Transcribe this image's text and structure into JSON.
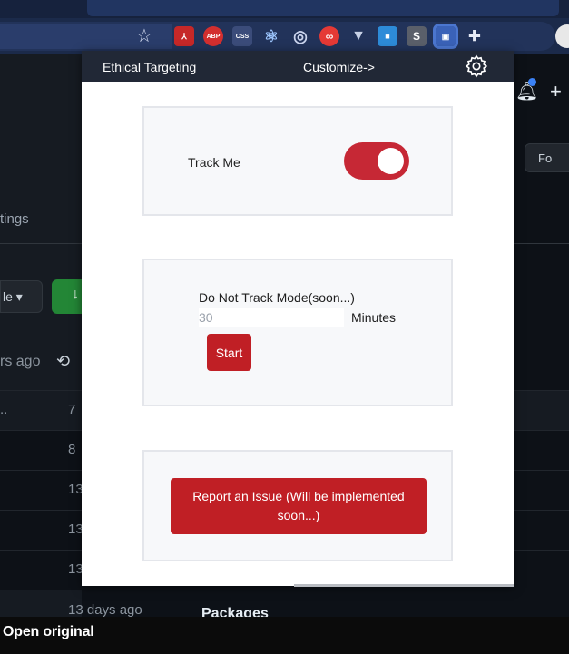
{
  "browser": {
    "extensions": [
      "pdf-icon",
      "abp-icon",
      "css-icon",
      "react-icon",
      "target-icon",
      "infinity-icon",
      "vue-icon",
      "blue-ext-icon",
      "s-ext-icon",
      "ethical-targeting-icon",
      "puzzle-icon"
    ],
    "ext_labels": {
      "abp": "ABP",
      "css": "CSS",
      "s": "S"
    }
  },
  "background": {
    "settings_tab": "tings",
    "fork_label": "Fo",
    "branch_label": "le ▾",
    "ago_text": "rs ago",
    "rows": [
      {
        "name": "..",
        "num": "7"
      },
      {
        "name": "",
        "num": "8"
      },
      {
        "name": "",
        "num": "13"
      },
      {
        "name": "",
        "num": "13"
      },
      {
        "name": "",
        "num": "13"
      }
    ],
    "last_age": "13 days ago",
    "packages": "Packages"
  },
  "popup": {
    "title": "Ethical Targeting",
    "customize": "Customize->",
    "track_label": "Track Me",
    "track_enabled": true,
    "dnt_label": "Do Not Track Mode(soon...)",
    "minutes_placeholder": "30",
    "minutes_label": "Minutes",
    "start_label": "Start",
    "report_label": "Report an Issue (Will be implemented soon...)"
  },
  "footer": {
    "open_original": "Open original"
  },
  "colors": {
    "accent_red": "#c01f25",
    "header_bg": "#212836"
  }
}
